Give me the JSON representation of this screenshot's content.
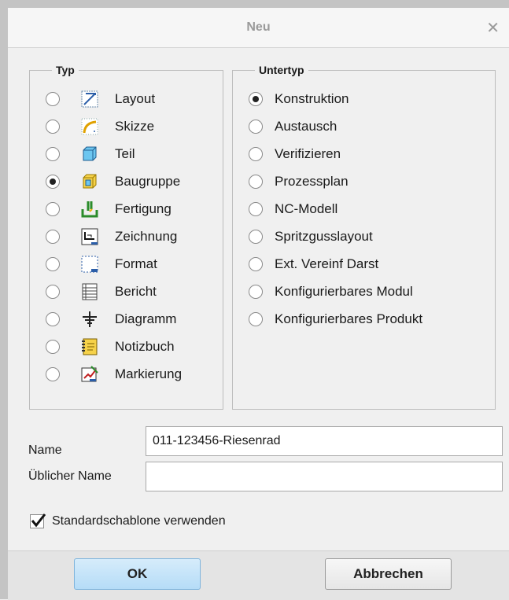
{
  "dialog": {
    "title": "Neu"
  },
  "typ": {
    "legend": "Typ",
    "items": [
      {
        "label": "Layout",
        "icon": "layout-icon",
        "selected": false
      },
      {
        "label": "Skizze",
        "icon": "sketch-icon",
        "selected": false
      },
      {
        "label": "Teil",
        "icon": "part-icon",
        "selected": false
      },
      {
        "label": "Baugruppe",
        "icon": "assembly-icon",
        "selected": true
      },
      {
        "label": "Fertigung",
        "icon": "manufacturing-icon",
        "selected": false
      },
      {
        "label": "Zeichnung",
        "icon": "drawing-icon",
        "selected": false
      },
      {
        "label": "Format",
        "icon": "format-icon",
        "selected": false
      },
      {
        "label": "Bericht",
        "icon": "report-icon",
        "selected": false
      },
      {
        "label": "Diagramm",
        "icon": "diagram-icon",
        "selected": false
      },
      {
        "label": "Notizbuch",
        "icon": "notebook-icon",
        "selected": false
      },
      {
        "label": "Markierung",
        "icon": "markup-icon",
        "selected": false
      }
    ]
  },
  "untertyp": {
    "legend": "Untertyp",
    "items": [
      {
        "label": "Konstruktion",
        "selected": true
      },
      {
        "label": "Austausch",
        "selected": false
      },
      {
        "label": "Verifizieren",
        "selected": false
      },
      {
        "label": "Prozessplan",
        "selected": false
      },
      {
        "label": "NC-Modell",
        "selected": false
      },
      {
        "label": "Spritzgusslayout",
        "selected": false
      },
      {
        "label": "Ext. Vereinf Darst",
        "selected": false
      },
      {
        "label": "Konfigurierbares Modul",
        "selected": false
      },
      {
        "label": "Konfigurierbares Produkt",
        "selected": false
      }
    ]
  },
  "name": {
    "label": "Name",
    "value": "011-123456-Riesenrad"
  },
  "common_name": {
    "label": "Üblicher Name",
    "value": ""
  },
  "template": {
    "label": "Standardschablone verwenden",
    "checked": true
  },
  "buttons": {
    "ok": "OK",
    "cancel": "Abbrechen"
  }
}
